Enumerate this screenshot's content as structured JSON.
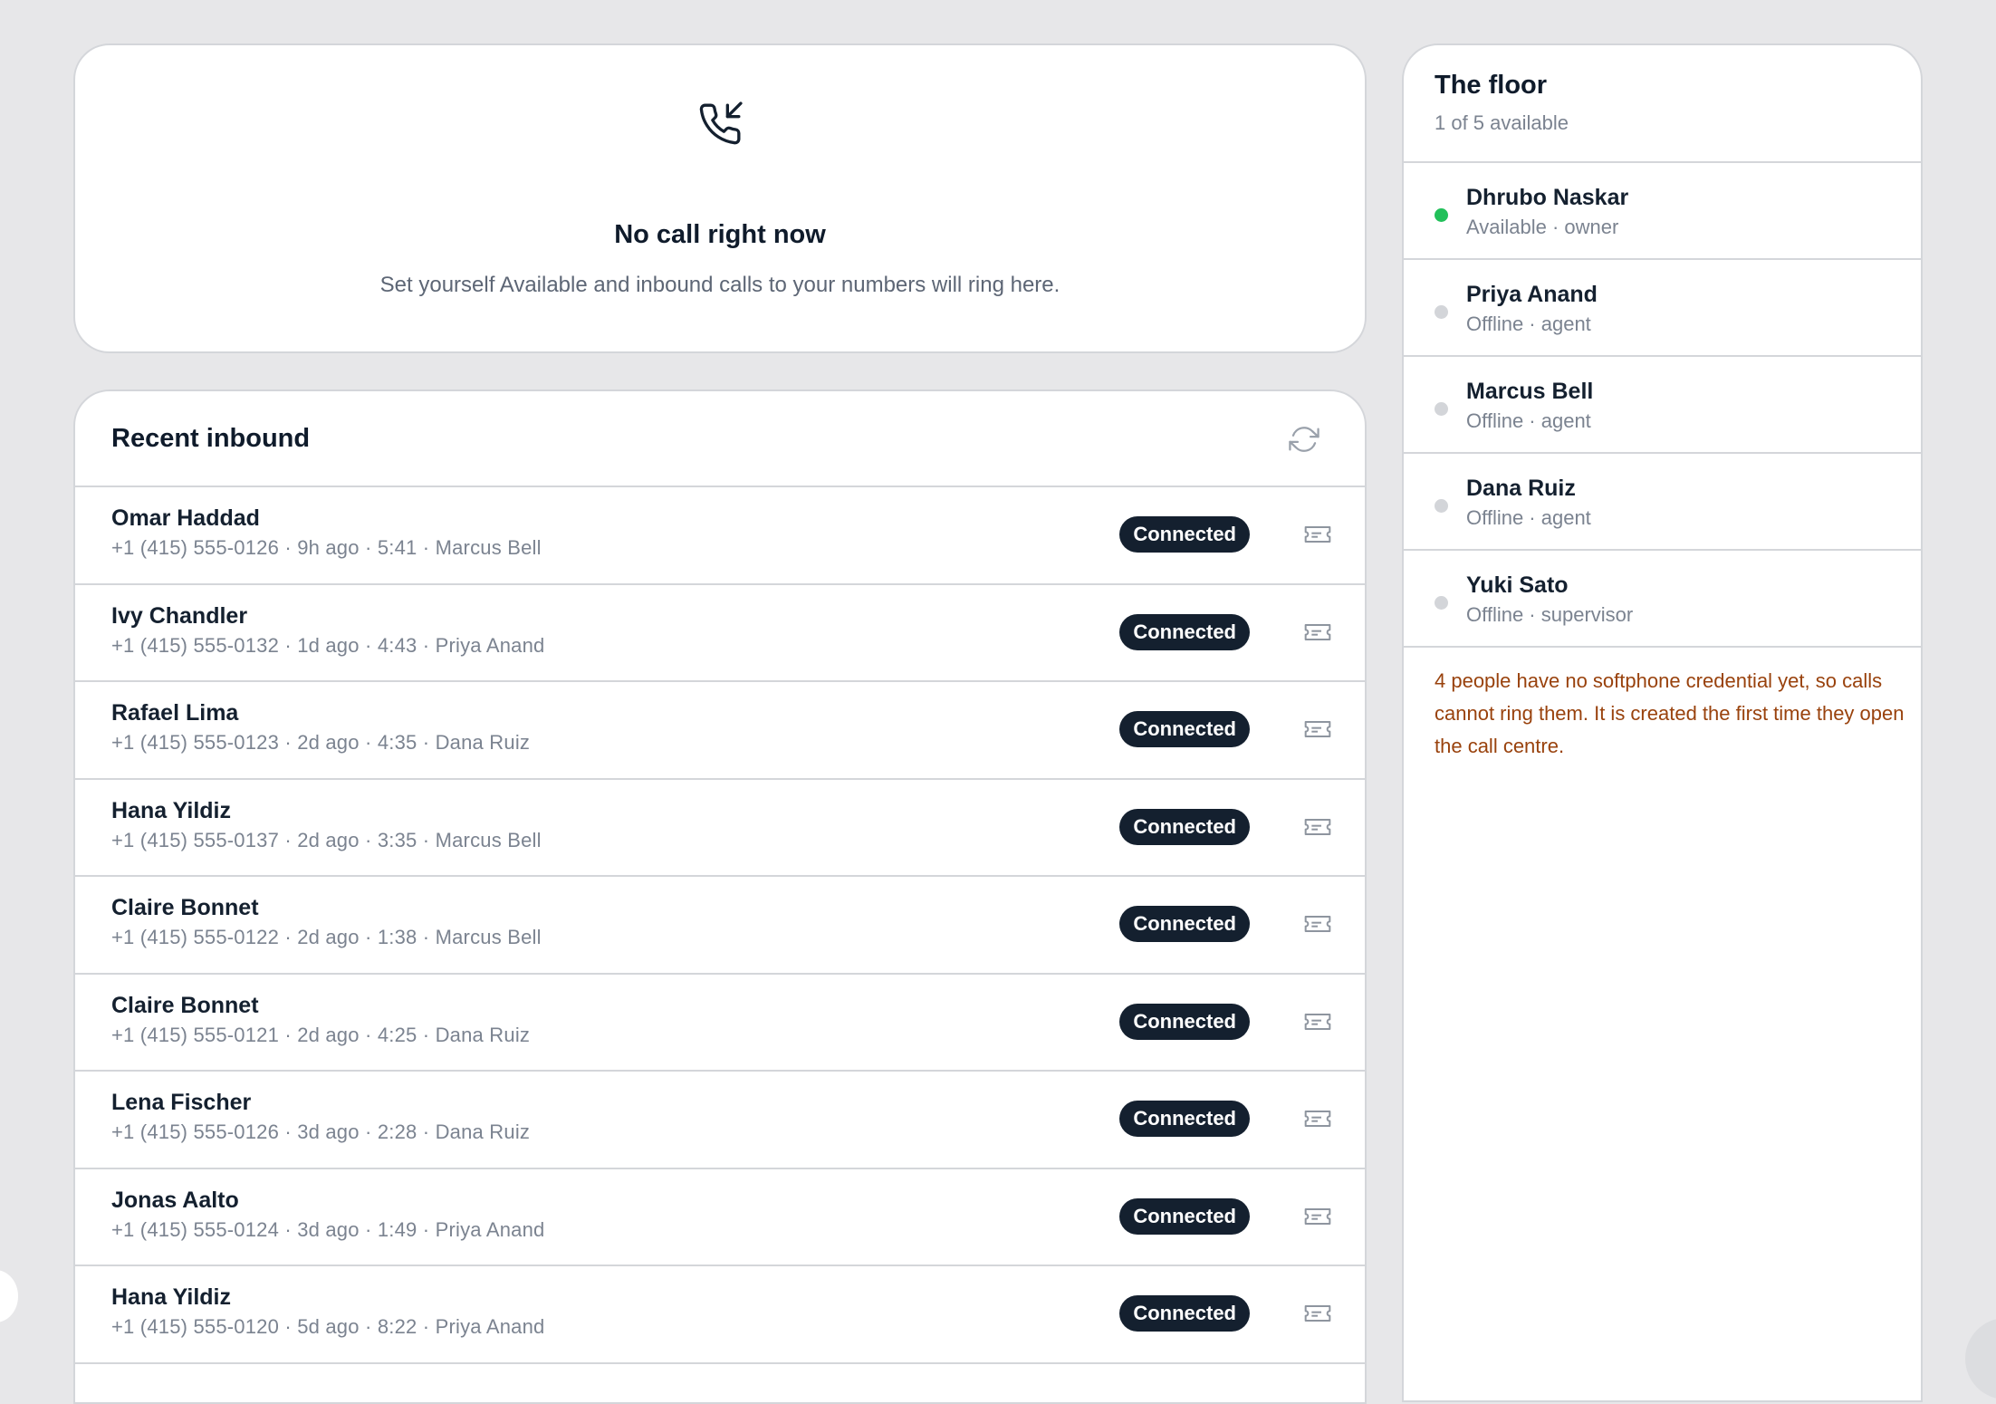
{
  "empty_call": {
    "icon": "phone-incoming-icon",
    "title": "No call right now",
    "description": "Set yourself Available and inbound calls to your numbers will ring here."
  },
  "recent_inbound": {
    "title": "Recent inbound",
    "refresh_icon": "refresh-icon",
    "row_action_icon": "ticket-icon",
    "rows": [
      {
        "name": "Omar Haddad",
        "meta": "+1 (415) 555-0126 · 9h ago · 5:41 · Marcus Bell",
        "status": "Connected"
      },
      {
        "name": "Ivy Chandler",
        "meta": "+1 (415) 555-0132 · 1d ago · 4:43 · Priya Anand",
        "status": "Connected"
      },
      {
        "name": "Rafael Lima",
        "meta": "+1 (415) 555-0123 · 2d ago · 4:35 · Dana Ruiz",
        "status": "Connected"
      },
      {
        "name": "Hana Yildiz",
        "meta": "+1 (415) 555-0137 · 2d ago · 3:35 · Marcus Bell",
        "status": "Connected"
      },
      {
        "name": "Claire Bonnet",
        "meta": "+1 (415) 555-0122 · 2d ago · 1:38 · Marcus Bell",
        "status": "Connected"
      },
      {
        "name": "Claire Bonnet",
        "meta": "+1 (415) 555-0121 · 2d ago · 4:25 · Dana Ruiz",
        "status": "Connected"
      },
      {
        "name": "Lena Fischer",
        "meta": "+1 (415) 555-0126 · 3d ago · 2:28 · Dana Ruiz",
        "status": "Connected"
      },
      {
        "name": "Jonas Aalto",
        "meta": "+1 (415) 555-0124 · 3d ago · 1:49 · Priya Anand",
        "status": "Connected"
      },
      {
        "name": "Hana Yildiz",
        "meta": "+1 (415) 555-0120 · 5d ago · 8:22 · Priya Anand",
        "status": "Connected"
      }
    ]
  },
  "floor": {
    "title": "The floor",
    "subtitle": "1 of 5 available",
    "people": [
      {
        "name": "Dhrubo Naskar",
        "role": "Available · owner",
        "online": true
      },
      {
        "name": "Priya Anand",
        "role": "Offline · agent",
        "online": false
      },
      {
        "name": "Marcus Bell",
        "role": "Offline · agent",
        "online": false
      },
      {
        "name": "Dana Ruiz",
        "role": "Offline · agent",
        "online": false
      },
      {
        "name": "Yuki Sato",
        "role": "Offline · supervisor",
        "online": false
      }
    ],
    "warning": "4 people have no softphone credential yet, so calls cannot ring them. It is created the first time they open the call centre."
  },
  "colors": {
    "page_bg": "#e7e7e9",
    "card_bg": "#ffffff",
    "badge_bg": "#14202f",
    "available_dot": "#22c05a",
    "offline_dot": "#d3d5d9",
    "warning_text": "#99420d"
  }
}
